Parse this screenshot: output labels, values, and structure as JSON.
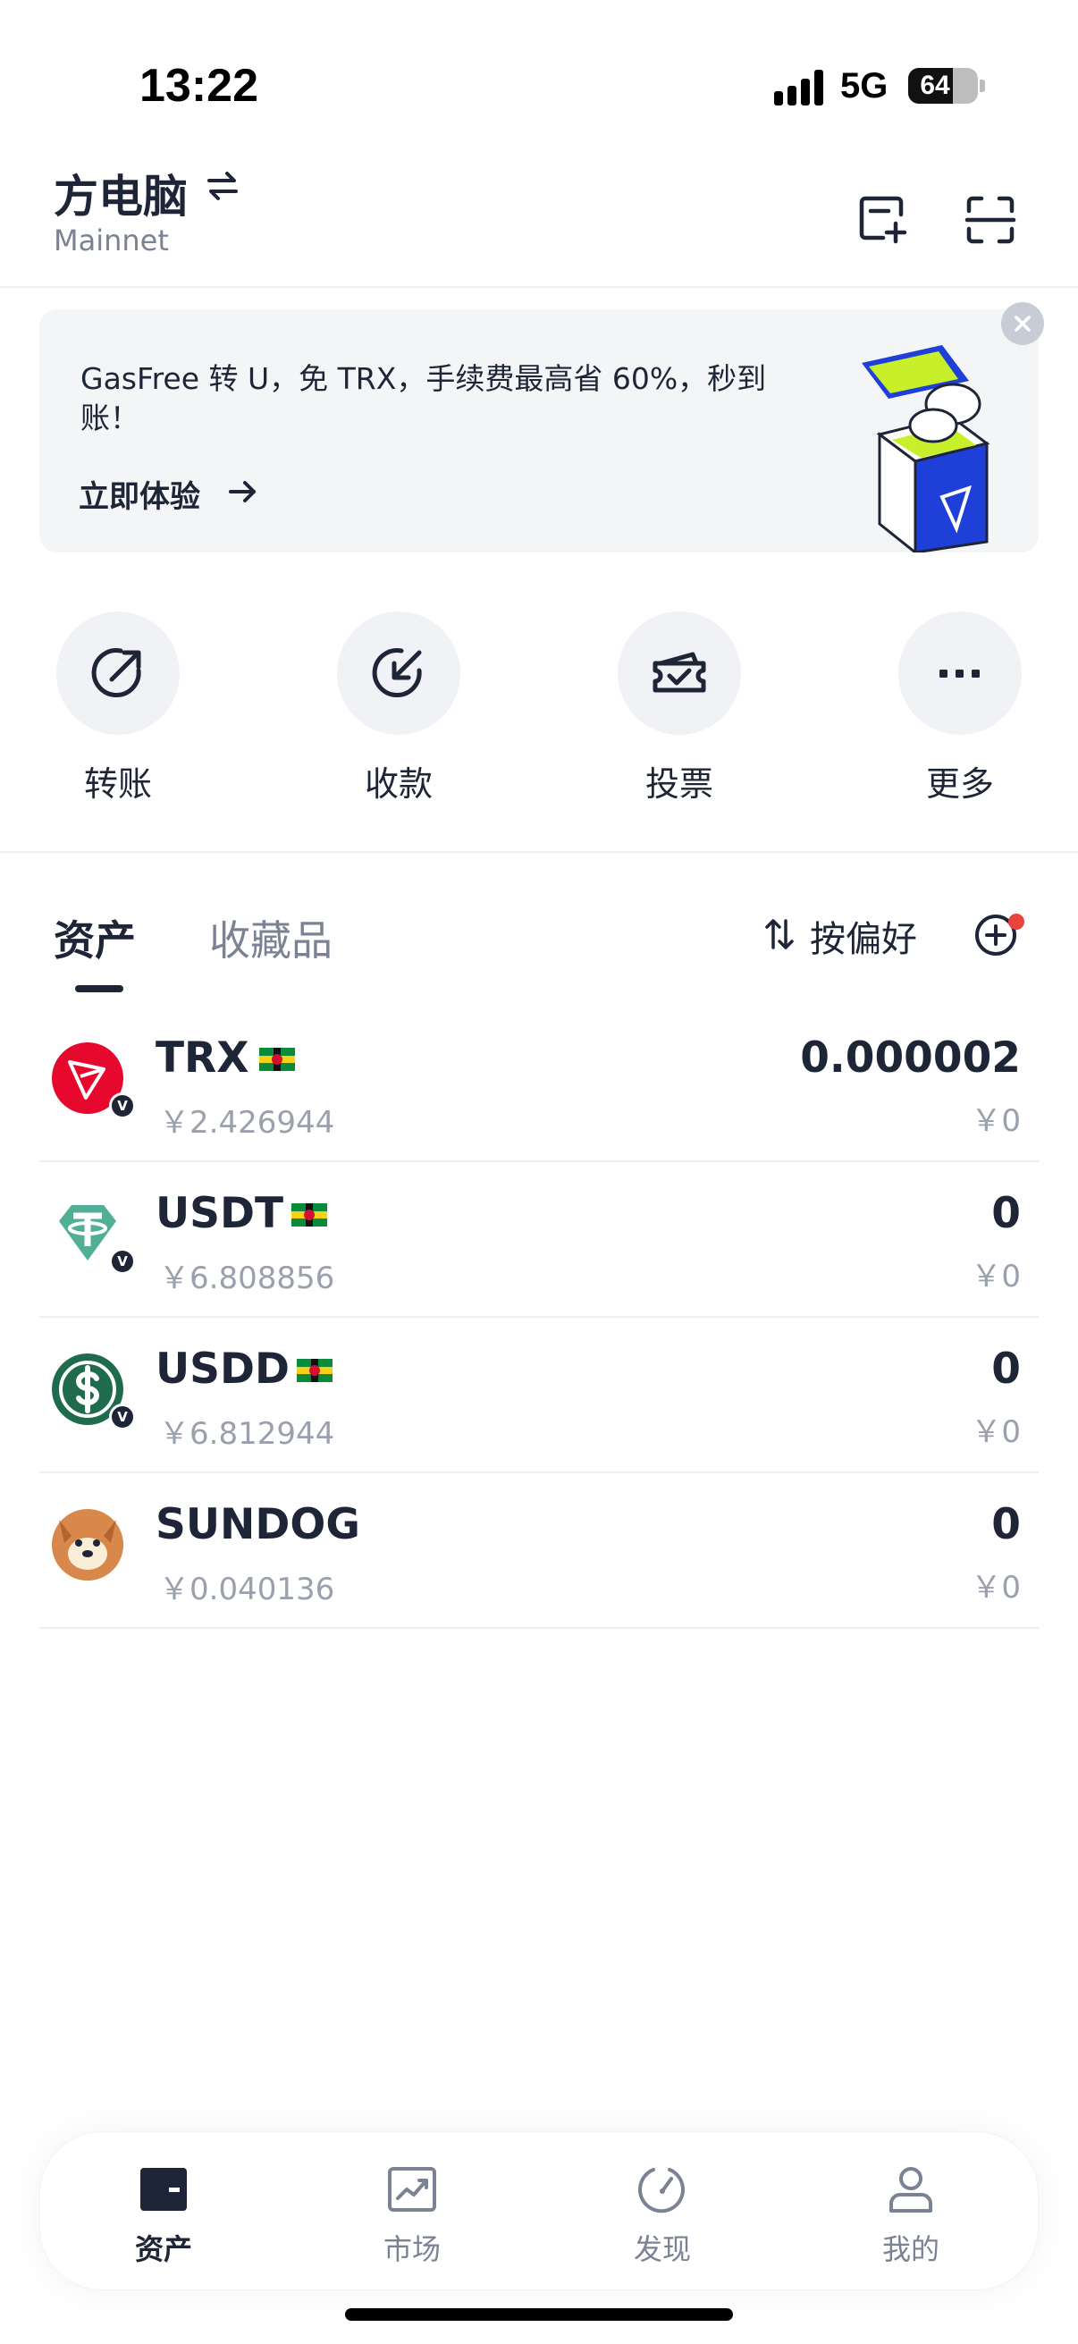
{
  "status_bar": {
    "time": "13:22",
    "network": "5G",
    "battery": "64",
    "battery_level": 0.64
  },
  "header": {
    "wallet_name": "方电脑",
    "network": "Mainnet"
  },
  "banner": {
    "text": "GasFree 转 U，免 TRX，手续费最高省 60%，秒到账！",
    "cta": "立即体验"
  },
  "actions": [
    {
      "label": "转账",
      "icon": "transfer-out-icon"
    },
    {
      "label": "收款",
      "icon": "receive-in-icon"
    },
    {
      "label": "投票",
      "icon": "ticket-vote-icon"
    },
    {
      "label": "更多",
      "icon": "more-dots-icon"
    }
  ],
  "tabs": {
    "assets": "资产",
    "collectibles": "收藏品",
    "sort": "按偏好"
  },
  "tokens": [
    {
      "symbol": "TRX",
      "price": "￥2.426944",
      "amount": "0.000002",
      "value": "￥0",
      "color": "#e6092d"
    },
    {
      "symbol": "USDT",
      "price": "￥6.808856",
      "amount": "0",
      "value": "￥0",
      "color": "#50af95"
    },
    {
      "symbol": "USDD",
      "price": "￥6.812944",
      "amount": "0",
      "value": "￥0",
      "color": "#1f6b4e"
    },
    {
      "symbol": "SUNDOG",
      "price": "￥0.040136",
      "amount": "0",
      "value": "￥0",
      "color": "#d9884b"
    }
  ],
  "bottom_nav": [
    {
      "label": "资产",
      "active": true
    },
    {
      "label": "市场",
      "active": false
    },
    {
      "label": "发现",
      "active": false
    },
    {
      "label": "我的",
      "active": false
    }
  ],
  "colors": {
    "primary": "#1e2537",
    "muted": "#7b8294",
    "badge_red": "#e8433d"
  }
}
